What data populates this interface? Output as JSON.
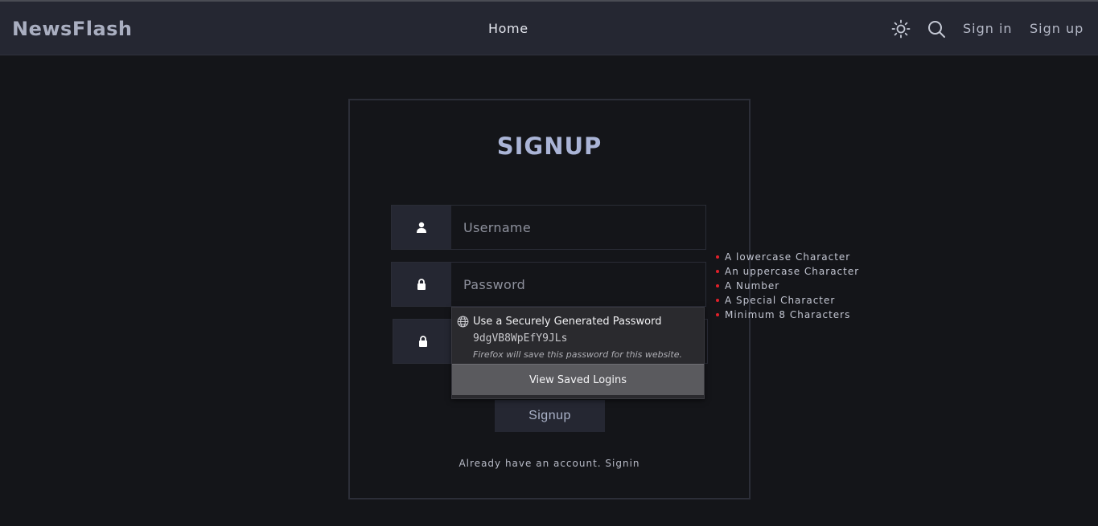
{
  "navbar": {
    "brand": "NewsFlash",
    "home": "Home",
    "signin": "Sign in",
    "signup": "Sign up",
    "icons": [
      "sun-icon",
      "search-icon"
    ]
  },
  "form": {
    "title": "SIGNUP",
    "username_placeholder": "Username",
    "password_placeholder": "Password",
    "confirm_placeholder": "",
    "submit": "Signup",
    "already": "Already have an account. Signin"
  },
  "password_rules": [
    "A lowercase Character",
    "An uppercase Character",
    "A Number",
    "A Special Character",
    "Minimum 8 Characters"
  ],
  "autofill_popup": {
    "heading": "Use a Securely Generated Password",
    "generated_password": "9dgVB8WpEfY9JLs",
    "note": "Firefox will save this password for this website.",
    "view_saved": "View Saved Logins"
  },
  "colors": {
    "background": "#141519",
    "navbar": "#252732",
    "title": "#aab4d6",
    "rule_bullet": "#e0202a"
  }
}
